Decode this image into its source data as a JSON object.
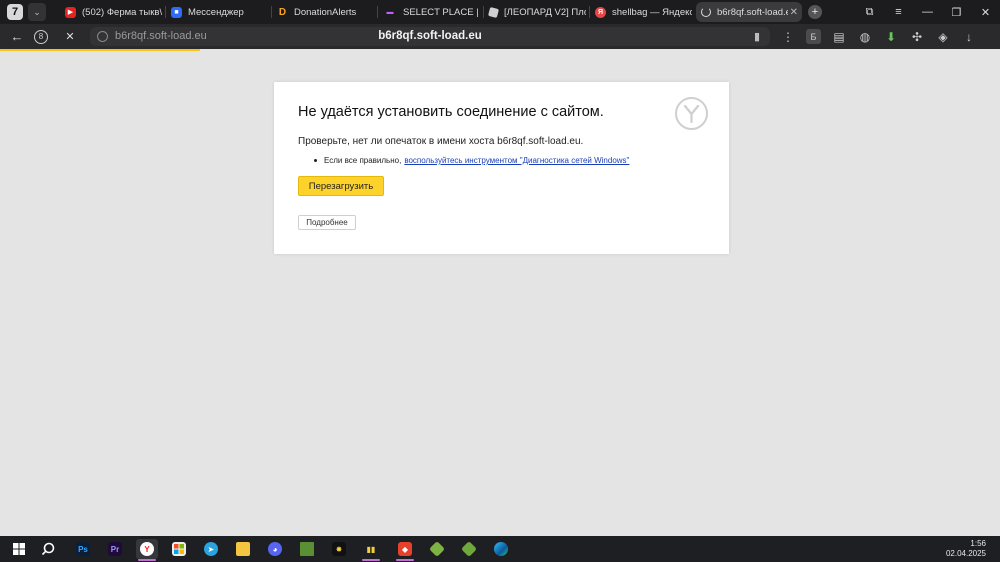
{
  "browser": {
    "tab_counter": "7",
    "tabs": [
      {
        "label": "(502) Ферма тыкв\\",
        "icon": "youtube-icon"
      },
      {
        "label": "Мессенджер",
        "icon": "messenger-icon"
      },
      {
        "label": "DonationAlerts",
        "icon": "donationalerts-icon"
      },
      {
        "label": "SELECT PLACE | Ис",
        "icon": "selectplace-icon"
      },
      {
        "label": "[ЛЕОПАРД V2] Пло",
        "icon": "roblox-icon"
      },
      {
        "label": "shellbag — Яндекс",
        "icon": "yandex-icon"
      },
      {
        "label": "b6r8qf.soft-load.e",
        "icon": "loading-icon",
        "active": true
      }
    ],
    "new_tab": "+",
    "window_controls": [
      "⧉",
      "≡",
      "—",
      "❐",
      "✕"
    ]
  },
  "toolbar": {
    "back": "←",
    "protect": "8",
    "stop": "✕",
    "address_host": "b6r8qf.soft-load.eu",
    "address_center": "b6r8qf.soft-load.eu",
    "bookmark": "▮",
    "more": "⋮",
    "ext_letter": "Б"
  },
  "error": {
    "title": "Не удаётся установить соединение с сайтом.",
    "hint": "Проверьте, нет ли опечаток в имени хоста b6r8qf.soft-load.eu.",
    "bullet_prefix": "Если все правильно,",
    "bullet_link": "воспользуйтесь инструментом \"Диагностика сетей Windows\"",
    "reload_button": "Перезагрузить",
    "details_button": "Подробнее"
  },
  "taskbar": {
    "apps": [
      "windows-start-icon",
      "search-icon",
      "photoshop-icon",
      "premiere-icon",
      "yandex-browser-icon",
      "ms-store-icon",
      "telegram-icon",
      "file-explorer-icon",
      "discord-icon",
      "minecraft-icon",
      "app-icon",
      "app-icon",
      "anydesk-icon",
      "minecraft-icon",
      "minecraft-icon",
      "edge-icon"
    ],
    "ps_label": "Ps",
    "pr_label": "Pr",
    "time": "1:56",
    "date": "02.04.2025"
  },
  "colors": {
    "accent": "#fdd22a",
    "link": "#1a3eb8",
    "page_bg": "#e4e4e4"
  }
}
